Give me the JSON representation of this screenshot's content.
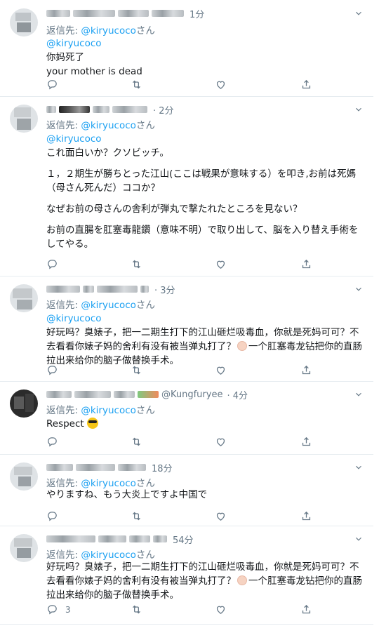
{
  "reply_prefix": "返信先:",
  "reply_to_handle": "@kiryucoco",
  "reply_suffix": "さん",
  "tweets": [
    {
      "time": "1分",
      "mention": "@kiryucoco",
      "lines": [
        "你妈死了",
        "your mother is dead"
      ],
      "reply_count": ""
    },
    {
      "time": "· 2分",
      "mention": "@kiryucoco",
      "lines": [
        "これ面白いか？クソビッチ。",
        "",
        "１，２期生が勝ちとった江山(ここは戦果が意味する）を叩き,お前は死媽",
        "（母さん死んだ）ココか？",
        "",
        "なぜお前の母さんの舎利が弾丸で撃たれたところを見ない？",
        "",
        "お前の直腸を肛塞毒龍鑽（意味不明）で取り出して、脳を入り替え手術を",
        "してやる。"
      ],
      "reply_count": ""
    },
    {
      "time": "· 3分",
      "mention": "@kiryucoco",
      "lines": [
        "好玩吗？臭婊子，把一二期生打下的江山砸烂吸毒血，你就是死妈可可？不",
        "去看看你婊子妈的舍利有没有被当弹丸打了？",
        "一个肛塞毒龙钻把你的直肠",
        "拉出来给你的脑子做替换手术。"
      ],
      "reply_count": ""
    },
    {
      "handle": "@Kungfuryee",
      "time": "· 4分",
      "mention": "",
      "lines": [
        "Respect"
      ],
      "reply_count": ""
    },
    {
      "time": "18分",
      "mention": "",
      "lines": [
        "やりますね、もう大炎上ですよ中国で"
      ],
      "reply_count": ""
    },
    {
      "time": "54分",
      "mention": "",
      "lines": [
        "好玩吗？臭婊子，把一二期生打下的江山砸烂吸毒血，你就是死妈可可？不",
        "去看看你婊子妈的舍利有没有被当弹丸打了？",
        "一个肛塞毒龙钻把你的直肠",
        "拉出来给你的脑子做替换手术。"
      ],
      "reply_count": "3"
    }
  ],
  "icons": [
    "caret-down-icon",
    "reply-icon",
    "retweet-icon",
    "like-icon",
    "share-icon"
  ],
  "colors": {
    "link": "#1da1f2",
    "muted": "#657786",
    "text": "#14171a",
    "divider": "#e6ecf0"
  }
}
